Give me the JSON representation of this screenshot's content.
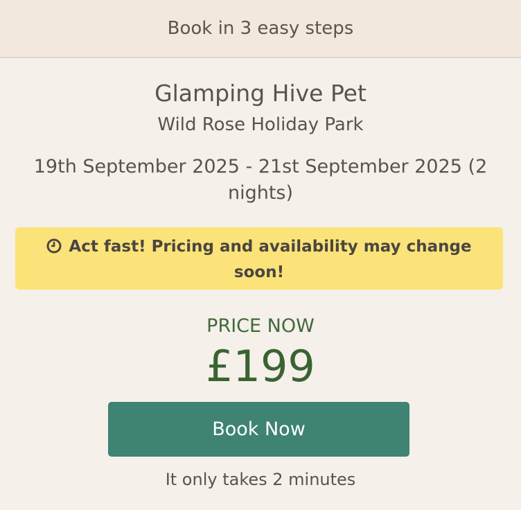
{
  "header": {
    "text": "Book in 3 easy steps"
  },
  "property": {
    "title": "Glamping Hive Pet",
    "park": "Wild Rose Holiday Park"
  },
  "stay": {
    "dates": "19th September 2025 - 21st September 2025 (2 nights)"
  },
  "alert": {
    "icon": "clock-icon",
    "text": "Act fast! Pricing and availability may change soon!",
    "background_color": "#fbe37a"
  },
  "pricing": {
    "label": "PRICE NOW",
    "amount": "£199",
    "color": "#3a6332"
  },
  "cta": {
    "label": "Book Now",
    "color": "#3f8372",
    "note": "It only takes 2 minutes"
  }
}
